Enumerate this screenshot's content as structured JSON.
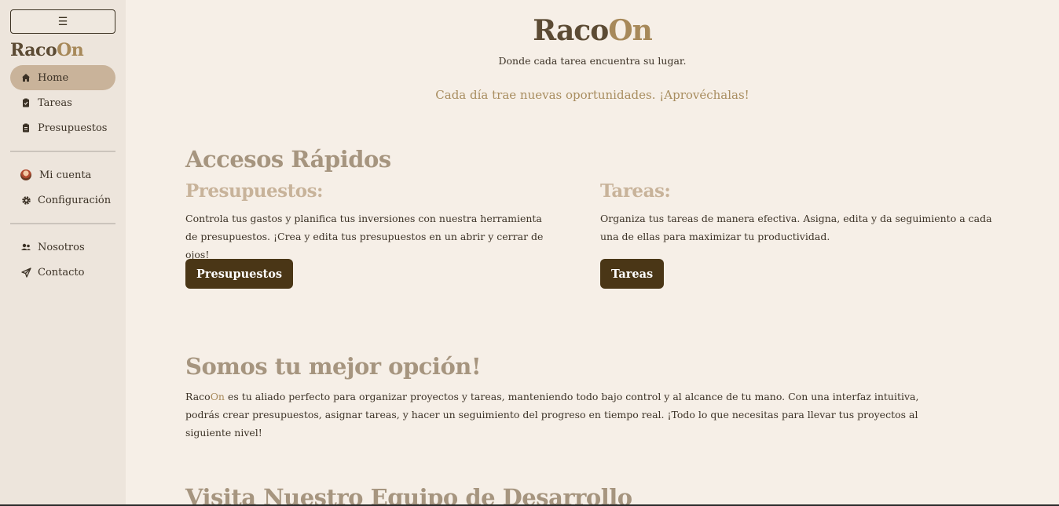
{
  "sidebar": {
    "toggle_label": "☰",
    "brand_part1": "Raco",
    "brand_part2": "On",
    "nav_main": [
      {
        "label": "Home",
        "icon": "home-icon",
        "active": true
      },
      {
        "label": "Tareas",
        "icon": "clipboard-icon"
      },
      {
        "label": "Presupuestos",
        "icon": "clipboard-icon"
      }
    ],
    "nav_account": [
      {
        "label": "Mi cuenta",
        "icon": "avatar"
      },
      {
        "label": "Configuración",
        "icon": "gear-icon"
      }
    ],
    "nav_info": [
      {
        "label": "Nosotros",
        "icon": "users-icon"
      },
      {
        "label": "Contacto",
        "icon": "paper-plane-icon"
      }
    ]
  },
  "hero": {
    "title_part1": "Raco",
    "title_part2": "On",
    "subtitle": "Donde cada tarea encuentra su lugar.",
    "tagline": "Cada día trae nuevas oportunidades. ¡Aprovéchalas!"
  },
  "quick_access": {
    "title": "Accesos Rápidos",
    "cards": [
      {
        "title": "Presupuestos:",
        "text": "Controla tus gastos y planifica tus inversiones con nuestra herramienta de presupuestos. ¡Crea y edita tus presupuestos en un abrir y cerrar de ojos!",
        "button": "Presupuestos"
      },
      {
        "title": "Tareas:",
        "text": "Organiza tus tareas de manera efectiva. Asigna, edita y da seguimiento a cada una de ellas para maximizar tu productividad.",
        "button": "Tareas"
      }
    ]
  },
  "best_option": {
    "title": "Somos tu mejor opción!",
    "brand_part1": "Raco",
    "brand_part2": "On",
    "text": " es tu aliado perfecto para organizar proyectos y tareas, manteniendo todo bajo control y al alcance de tu mano. Con una interfaz intuitiva, podrás crear presupuestos, asignar tareas, y hacer un seguimiento del progreso en tiempo real. ¡Todo lo que necesitas para llevar tus proyectos al siguiente nivel!"
  },
  "team": {
    "title": "Visita Nuestro Equipo de Desarrollo"
  },
  "colors": {
    "accent_dark": "#4a3616",
    "brand_light": "#a7895a",
    "active_nav": "#c9b39a"
  }
}
